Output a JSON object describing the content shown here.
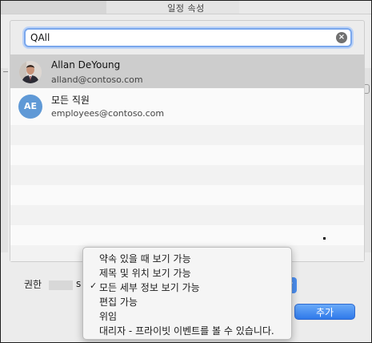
{
  "window": {
    "title": "일정 속성"
  },
  "search": {
    "value": "QAll",
    "clear_icon": "clear-circle-icon"
  },
  "results": [
    {
      "name": "Allan DeYoung",
      "email": "alland@contoso.com",
      "avatar": "photo",
      "selected": true
    },
    {
      "name": "모든 직원",
      "email": "employees@contoso.com",
      "avatar_initials": "AE",
      "avatar_color": "#5f99d6",
      "selected": false
    }
  ],
  "permissions": {
    "label": "권한",
    "hidden_value_prefix": "s",
    "menu": [
      {
        "label": "약속 있을 때 보기 가능",
        "checked": false
      },
      {
        "label": "제목 및 위치 보기 가능",
        "checked": false
      },
      {
        "label": "모든 세부 정보 보기 가능",
        "checked": true
      },
      {
        "label": "편집 가능",
        "checked": false
      },
      {
        "label": "위임",
        "checked": false
      },
      {
        "label": "대리자 - 프라이빗 이벤트를 볼 수 있습니다.",
        "checked": false
      }
    ],
    "checkmark": "✓"
  },
  "buttons": {
    "add_label": "추가"
  },
  "colors": {
    "accent": "#4c8ff0",
    "selected_row": "#cdcdcd",
    "initials_avatar": "#5f99d6"
  }
}
